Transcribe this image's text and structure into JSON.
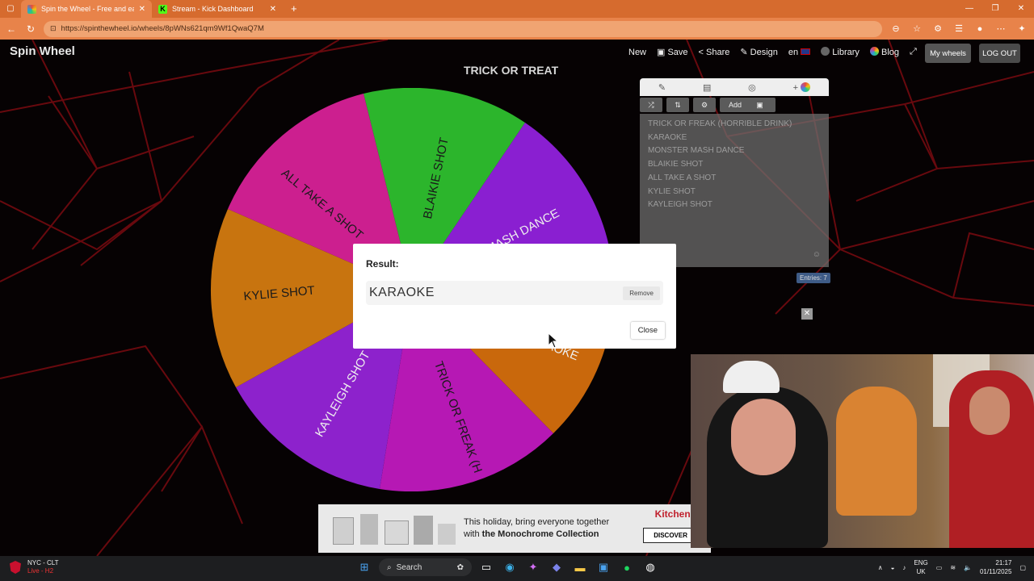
{
  "browser": {
    "tabs": [
      {
        "title": "Spin the Wheel - Free and easy-t",
        "active": true,
        "favicon_color": "#e74c3c"
      },
      {
        "title": "Stream - Kick Dashboard",
        "active": false,
        "favicon_color": "#53fc18"
      }
    ],
    "url": "https://spinthewheel.io/wheels/8pWNs621qm9Wf1QwaQ7M"
  },
  "site": {
    "logo": "Spin Wheel",
    "nav": [
      "New",
      "Save",
      "Share",
      "Design",
      "en",
      "Library",
      "Blog"
    ],
    "my_wheels": "My wheels",
    "logout": "LOG OUT"
  },
  "wheel": {
    "title": "TRICK OR TREAT",
    "colors": {
      "green": "#2cb52c",
      "purple": "#8a1fd1",
      "orange": "#d2740f",
      "magenta": "#c8169a",
      "pink": "#d02a8f"
    },
    "visible_labels": [
      "BLAIKIE SHOT",
      "ER MASH DANCE",
      "AOKE",
      "TRICK OR FREAK (H",
      "KAYLEIGH SHOT",
      "KYLIE SHOT",
      "ALL TAKE A SHOT"
    ]
  },
  "editor": {
    "add_label": "Add",
    "entries": [
      "TRICK OR FREAK (HORRIBLE DRINK)",
      "KARAOKE",
      "MONSTER MASH DANCE",
      "BLAIKIE SHOT",
      "ALL TAKE A SHOT",
      "KYLIE SHOT",
      "KAYLEIGH SHOT"
    ],
    "count_label": "Entries: 7"
  },
  "result": {
    "label": "Result:",
    "value": "KARAOKE",
    "remove": "Remove",
    "close": "Close"
  },
  "ad": {
    "line1": "This holiday, bring everyone together",
    "line2_prefix": "with",
    "line2_bold": "the Monochrome Collection",
    "brand": "KitchenAid",
    "cta": "DISCOVER"
  },
  "taskbar": {
    "weather_line1": "NYC - CLT",
    "weather_line2": "Live - H2",
    "search": "Search",
    "lang1": "ENG",
    "lang2": "UK",
    "time": "21:17",
    "date": "01/11/2025"
  }
}
